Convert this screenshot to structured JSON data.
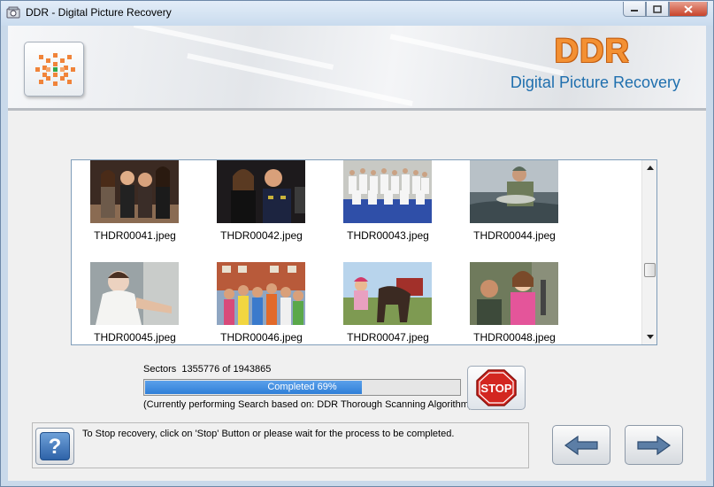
{
  "window": {
    "title": "DDR - Digital Picture Recovery",
    "controls": {
      "minimize": "–",
      "maximize": "□",
      "close": "✕"
    }
  },
  "banner": {
    "brand": "DDR",
    "subtitle": "Digital Picture Recovery",
    "colors": {
      "brand_orange": "#f39033",
      "subtitle_blue": "#1f6fae"
    }
  },
  "thumbnails": [
    {
      "name": "THDR00041.jpeg",
      "photo": "group-of-four-women"
    },
    {
      "name": "THDR00042.jpeg",
      "photo": "woman-and-man-in-uniform"
    },
    {
      "name": "THDR00043.jpeg",
      "photo": "karate-class-group"
    },
    {
      "name": "THDR00044.jpeg",
      "photo": "man-holding-fish"
    },
    {
      "name": "THDR00045.jpeg",
      "photo": "baby-in-white"
    },
    {
      "name": "THDR00046.jpeg",
      "photo": "group-in-street"
    },
    {
      "name": "THDR00047.jpeg",
      "photo": "girl-with-horse"
    },
    {
      "name": "THDR00048.jpeg",
      "photo": "father-and-daughter"
    }
  ],
  "progress": {
    "sectors_label": "Sectors",
    "sectors_value": "1355776 of 1943865",
    "completed_text": "Completed 69%",
    "percent": 69,
    "algorithm_text": "(Currently performing Search based on:  DDR Thorough Scanning Algorithm)"
  },
  "buttons": {
    "stop": "STOP",
    "help": "?",
    "back": "back-arrow-icon",
    "next": "next-arrow-icon"
  },
  "info": {
    "message": "To Stop recovery, click on 'Stop' Button or please wait for the process to be completed."
  }
}
